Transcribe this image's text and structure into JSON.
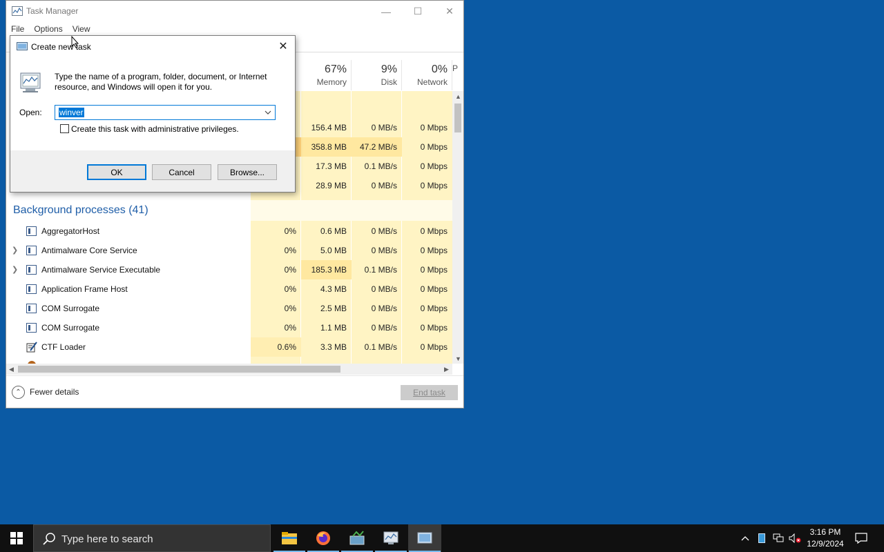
{
  "task_manager": {
    "title": "Task Manager",
    "menu": [
      "File",
      "Options",
      "View"
    ],
    "columns": [
      {
        "pct": "67%",
        "label": "Memory"
      },
      {
        "pct": "9%",
        "label": "Disk"
      },
      {
        "pct": "0%",
        "label": "Network"
      },
      {
        "pct": "",
        "label": "P"
      }
    ],
    "app_rows": [
      {
        "mem": "156.4 MB",
        "disk": "0 MB/s",
        "net": "0 Mbps"
      },
      {
        "mem": "358.8 MB",
        "disk": "47.2 MB/s",
        "net": "0 Mbps"
      },
      {
        "mem": "17.3 MB",
        "disk": "0.1 MB/s",
        "net": "0 Mbps"
      },
      {
        "mem": "28.9 MB",
        "disk": "0 MB/s",
        "net": "0 Mbps"
      }
    ],
    "background_header": "Background processes (41)",
    "processes": [
      {
        "name": "AggregatorHost",
        "cpu": "0%",
        "mem": "0.6 MB",
        "disk": "0 MB/s",
        "net": "0 Mbps",
        "expandable": false
      },
      {
        "name": "Antimalware Core Service",
        "cpu": "0%",
        "mem": "5.0 MB",
        "disk": "0 MB/s",
        "net": "0 Mbps",
        "expandable": true
      },
      {
        "name": "Antimalware Service Executable",
        "cpu": "0%",
        "mem": "185.3 MB",
        "disk": "0.1 MB/s",
        "net": "0 Mbps",
        "expandable": true
      },
      {
        "name": "Application Frame Host",
        "cpu": "0%",
        "mem": "4.3 MB",
        "disk": "0 MB/s",
        "net": "0 Mbps",
        "expandable": false
      },
      {
        "name": "COM Surrogate",
        "cpu": "0%",
        "mem": "2.5 MB",
        "disk": "0 MB/s",
        "net": "0 Mbps",
        "expandable": false
      },
      {
        "name": "COM Surrogate",
        "cpu": "0%",
        "mem": "1.1 MB",
        "disk": "0 MB/s",
        "net": "0 Mbps",
        "expandable": false
      },
      {
        "name": "CTF Loader",
        "cpu": "0.6%",
        "mem": "3.3 MB",
        "disk": "0.1 MB/s",
        "net": "0 Mbps",
        "expandable": false
      }
    ],
    "fewer_details": "Fewer details",
    "end_task": "End task"
  },
  "dialog": {
    "title": "Create new task",
    "description": "Type the name of a program, folder, document, or Internet resource, and Windows will open it for you.",
    "open_label": "Open:",
    "open_value": "winver",
    "admin_checkbox_label": "Create this task with administrative privileges.",
    "admin_checked": false,
    "ok": "OK",
    "cancel": "Cancel",
    "browse": "Browse..."
  },
  "taskbar": {
    "search_placeholder": "Type here to search",
    "apps": [
      "file-explorer-icon",
      "firefox-icon",
      "app-icon",
      "app-icon",
      "task-manager-icon"
    ],
    "time": "3:16 PM",
    "date": "12/9/2024"
  },
  "colors": {
    "desktop": "#0b5aa4",
    "heat_light": "#fff4c4",
    "heat_mid": "#ffe8a0",
    "heat_strong": "#ffd27a",
    "accent": "#0078d7"
  }
}
